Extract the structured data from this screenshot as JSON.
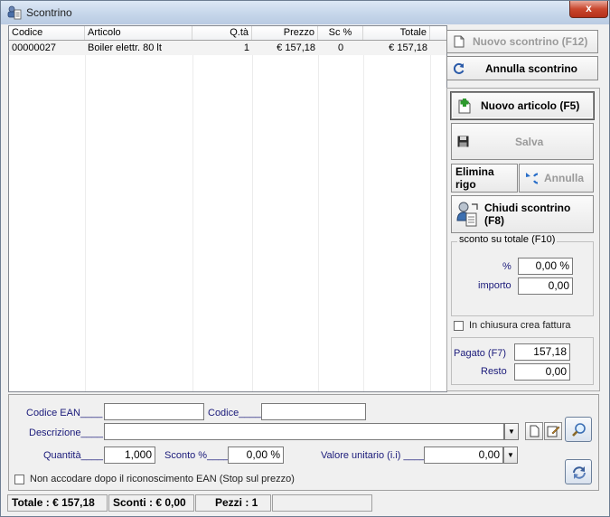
{
  "window": {
    "title": "Scontrino",
    "close_glyph": "x"
  },
  "grid": {
    "columns": [
      "Codice",
      "Articolo",
      "Q.tà",
      "Prezzo",
      "Sc %",
      "Totale"
    ],
    "rows": [
      {
        "codice": "00000027",
        "articolo": "Boiler elettr. 80 lt",
        "qta": "1",
        "prezzo": "€ 157,18",
        "sconto": "0",
        "totale": "€ 157,18"
      }
    ]
  },
  "actions": {
    "nuovo_scontrino": "Nuovo scontrino (F12)",
    "annulla_scontrino": "Annulla scontrino",
    "nuovo_articolo": "Nuovo articolo (F5)",
    "salva": "Salva",
    "elimina_rigo": "Elimina rigo",
    "annulla": "Annulla",
    "chiudi_scontrino": "Chiudi scontrino (F8)"
  },
  "discount": {
    "group_title": "sconto su totale (F10)",
    "percent_label": "%",
    "percent_value": "0,00 %",
    "importo_label": "importo",
    "importo_value": "0,00"
  },
  "invoice": {
    "label": "In chiusura crea fattura",
    "checked": false
  },
  "payment": {
    "pagato_label": "Pagato  (F7)",
    "pagato_value": "157,18",
    "resto_label": "Resto",
    "resto_value": "0,00"
  },
  "entry": {
    "codice_ean_label": "Codice EAN____",
    "codice_ean_value": "",
    "codice_label": "Codice____",
    "codice_value": "",
    "descrizione_label": "Descrizione____",
    "descrizione_value": "",
    "quantita_label": "Quantità____",
    "quantita_value": "1,000",
    "sconto_label": "Sconto %____",
    "sconto_value": "0,00 %",
    "valore_label": "Valore unitario (i.i) ____",
    "valore_value": "0,00",
    "stop_label": "Non accodare dopo il riconoscimento EAN (Stop sul prezzo)",
    "stop_checked": false
  },
  "status": {
    "totale": "Totale : € 157,18",
    "sconti": "Sconti : € 0,00",
    "pezzi": "Pezzi : 1",
    "extra": ""
  },
  "icons": {
    "app": "receipt-app-icon",
    "new_doc": "new-document-icon",
    "undo": "undo-icon",
    "new_item": "new-item-icon",
    "save": "floppy-disk-icon",
    "redo": "redo-icon",
    "checkout": "cashier-icon",
    "search": "magnifier-icon",
    "refresh": "refresh-icon"
  }
}
